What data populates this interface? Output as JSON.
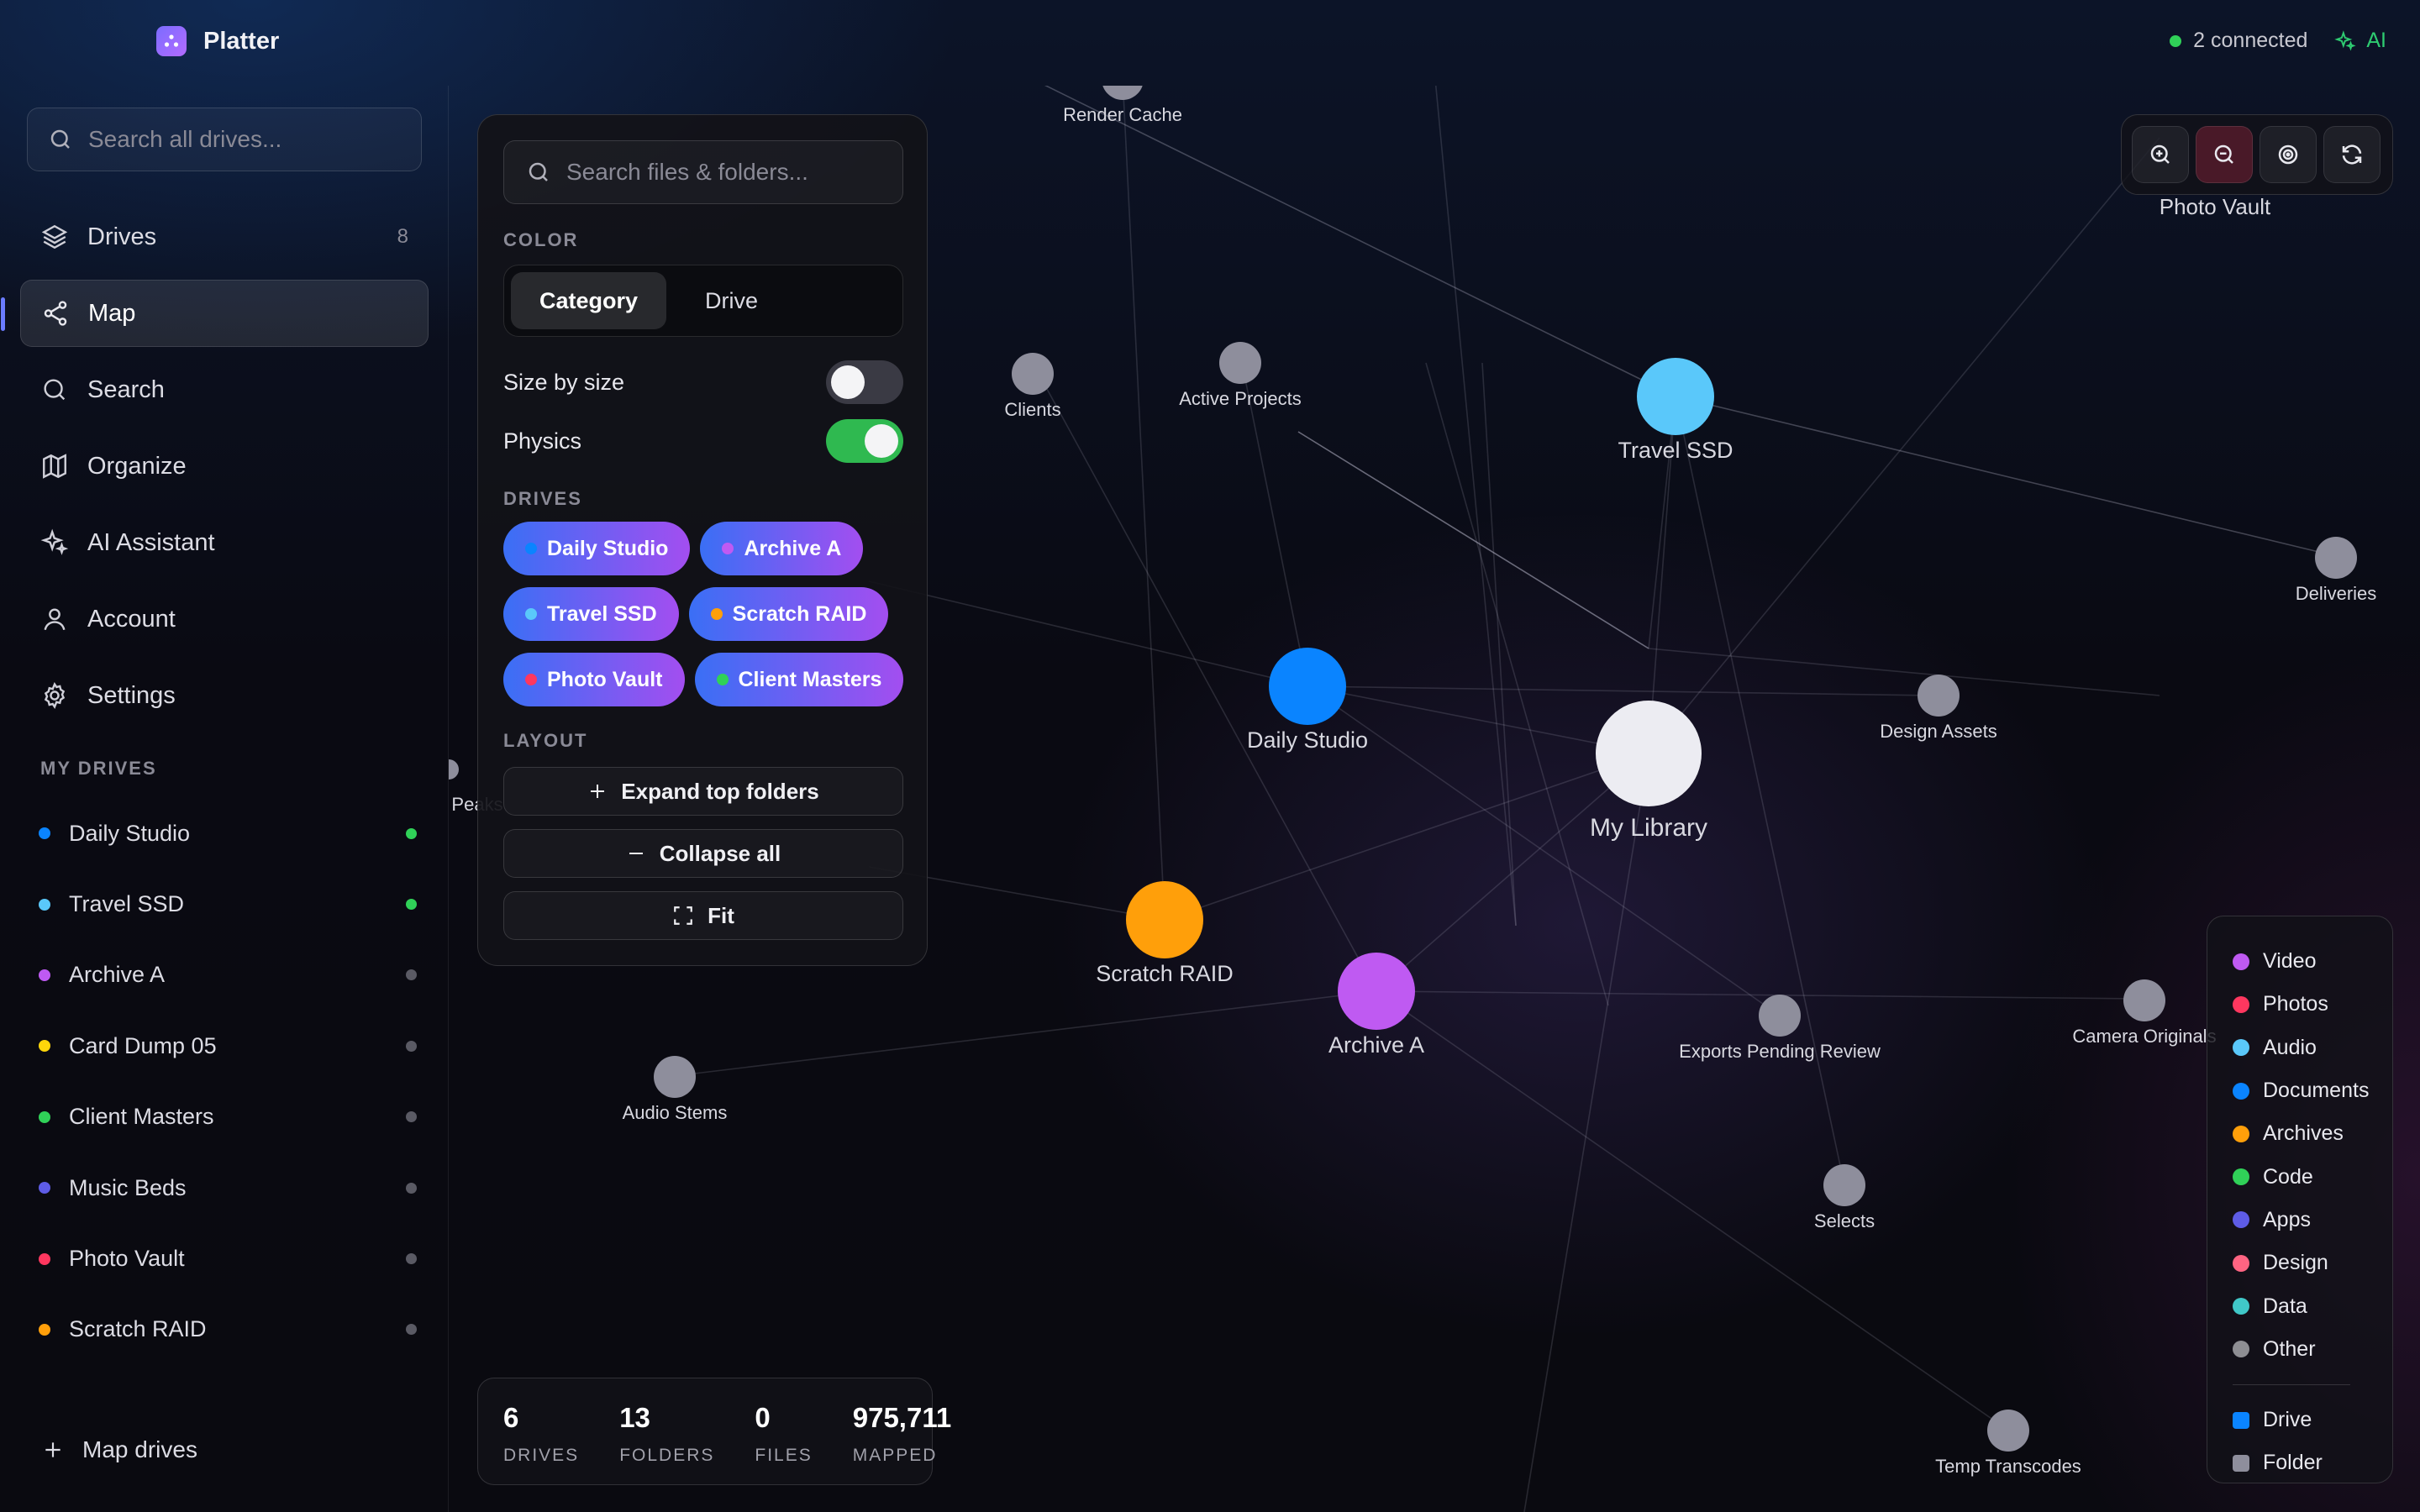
{
  "app": {
    "name": "Platter"
  },
  "topbar": {
    "connected_label": "2 connected",
    "ai_label": "AI"
  },
  "sidebar": {
    "search_placeholder": "Search all drives...",
    "nav": [
      {
        "label": "Drives",
        "icon": "layers-icon",
        "badge": "8"
      },
      {
        "label": "Map",
        "icon": "share-graph-icon",
        "active": true
      },
      {
        "label": "Search",
        "icon": "search-icon"
      },
      {
        "label": "Organize",
        "icon": "map-icon"
      },
      {
        "label": "AI Assistant",
        "icon": "sparkles-icon"
      },
      {
        "label": "Account",
        "icon": "user-icon"
      },
      {
        "label": "Settings",
        "icon": "gear-icon"
      }
    ],
    "section_title": "MY DRIVES",
    "drives": [
      {
        "name": "Daily Studio",
        "color": "#0a84ff",
        "online": true
      },
      {
        "name": "Travel SSD",
        "color": "#5ac8fa",
        "online": true
      },
      {
        "name": "Archive A",
        "color": "#bf5af2",
        "online": false
      },
      {
        "name": "Card Dump 05",
        "color": "#ffd60a",
        "online": false
      },
      {
        "name": "Client Masters",
        "color": "#30d158",
        "online": false
      },
      {
        "name": "Music Beds",
        "color": "#5e5ce6",
        "online": false
      },
      {
        "name": "Photo Vault",
        "color": "#ff375f",
        "online": false
      },
      {
        "name": "Scratch RAID",
        "color": "#ff9f0a",
        "online": false
      }
    ],
    "map_drives_label": "Map drives"
  },
  "panel": {
    "search_placeholder": "Search files & folders...",
    "color_title": "COLOR",
    "color_options": [
      "Category",
      "Drive"
    ],
    "size_by_size_label": "Size by size",
    "size_by_size_on": false,
    "physics_label": "Physics",
    "physics_on": true,
    "drives_title": "DRIVES",
    "drive_chips": [
      {
        "name": "Daily Studio",
        "color": "#0a84ff"
      },
      {
        "name": "Archive A",
        "color": "#bf5af2"
      },
      {
        "name": "Travel SSD",
        "color": "#5ac8fa"
      },
      {
        "name": "Scratch RAID",
        "color": "#ff9f0a"
      },
      {
        "name": "Photo Vault",
        "color": "#ff375f"
      },
      {
        "name": "Client Masters",
        "color": "#30d158"
      }
    ],
    "layout_title": "LAYOUT",
    "expand_label": "Expand top folders",
    "collapse_label": "Collapse all",
    "fit_label": "Fit"
  },
  "zoom_controls": [
    "zoom-in-icon",
    "zoom-out-icon",
    "target-icon",
    "refresh-icon"
  ],
  "graph": {
    "nodes": [
      {
        "id": "lib",
        "label": "My Library",
        "type": "root",
        "color": "#ececf2"
      },
      {
        "id": "daily",
        "label": "Daily Studio",
        "type": "drive",
        "color": "#0a84ff"
      },
      {
        "id": "travel",
        "label": "Travel SSD",
        "type": "drive",
        "color": "#5ac8fa"
      },
      {
        "id": "scratch",
        "label": "Scratch RAID",
        "type": "drive",
        "color": "#ff9f0a"
      },
      {
        "id": "archive",
        "label": "Archive A",
        "type": "drive",
        "color": "#bf5af2"
      },
      {
        "id": "render",
        "label": "Render Cache",
        "type": "folder"
      },
      {
        "id": "clients",
        "label": "Clients",
        "type": "folder"
      },
      {
        "id": "active",
        "label": "Active Projects",
        "type": "folder"
      },
      {
        "id": "photovault",
        "label": "Photo Vault",
        "type": "folder"
      },
      {
        "id": "deliveries",
        "label": "Deliveries",
        "type": "folder"
      },
      {
        "id": "design",
        "label": "Design Assets",
        "type": "folder"
      },
      {
        "id": "exports",
        "label": "Exports Pending Review",
        "type": "folder"
      },
      {
        "id": "camera",
        "label": "Camera Originals",
        "type": "folder"
      },
      {
        "id": "selects",
        "label": "Selects",
        "type": "folder"
      },
      {
        "id": "audio",
        "label": "Audio Stems",
        "type": "folder"
      },
      {
        "id": "temp",
        "label": "Temp Transcodes",
        "type": "folder"
      },
      {
        "id": "peaks",
        "label": "Peaks",
        "type": "folder"
      }
    ],
    "folder_color": "#8e8e9c"
  },
  "legend": {
    "categories": [
      {
        "label": "Video",
        "color": "#bf5af2"
      },
      {
        "label": "Photos",
        "color": "#ff375f"
      },
      {
        "label": "Audio",
        "color": "#5ac8fa"
      },
      {
        "label": "Documents",
        "color": "#0a84ff"
      },
      {
        "label": "Archives",
        "color": "#ff9f0a"
      },
      {
        "label": "Code",
        "color": "#30d158"
      },
      {
        "label": "Apps",
        "color": "#5e5ce6"
      },
      {
        "label": "Design",
        "color": "#ff6482"
      },
      {
        "label": "Data",
        "color": "#40c8c8"
      },
      {
        "label": "Other",
        "color": "#8e8e93"
      }
    ],
    "types": [
      {
        "label": "Drive",
        "color": "#0a84ff"
      },
      {
        "label": "Folder",
        "color": "#8e8e9c"
      }
    ]
  },
  "stats": [
    {
      "value": "6",
      "label": "DRIVES"
    },
    {
      "value": "13",
      "label": "FOLDERS"
    },
    {
      "value": "0",
      "label": "FILES"
    },
    {
      "value": "975,711",
      "label": "MAPPED"
    }
  ]
}
